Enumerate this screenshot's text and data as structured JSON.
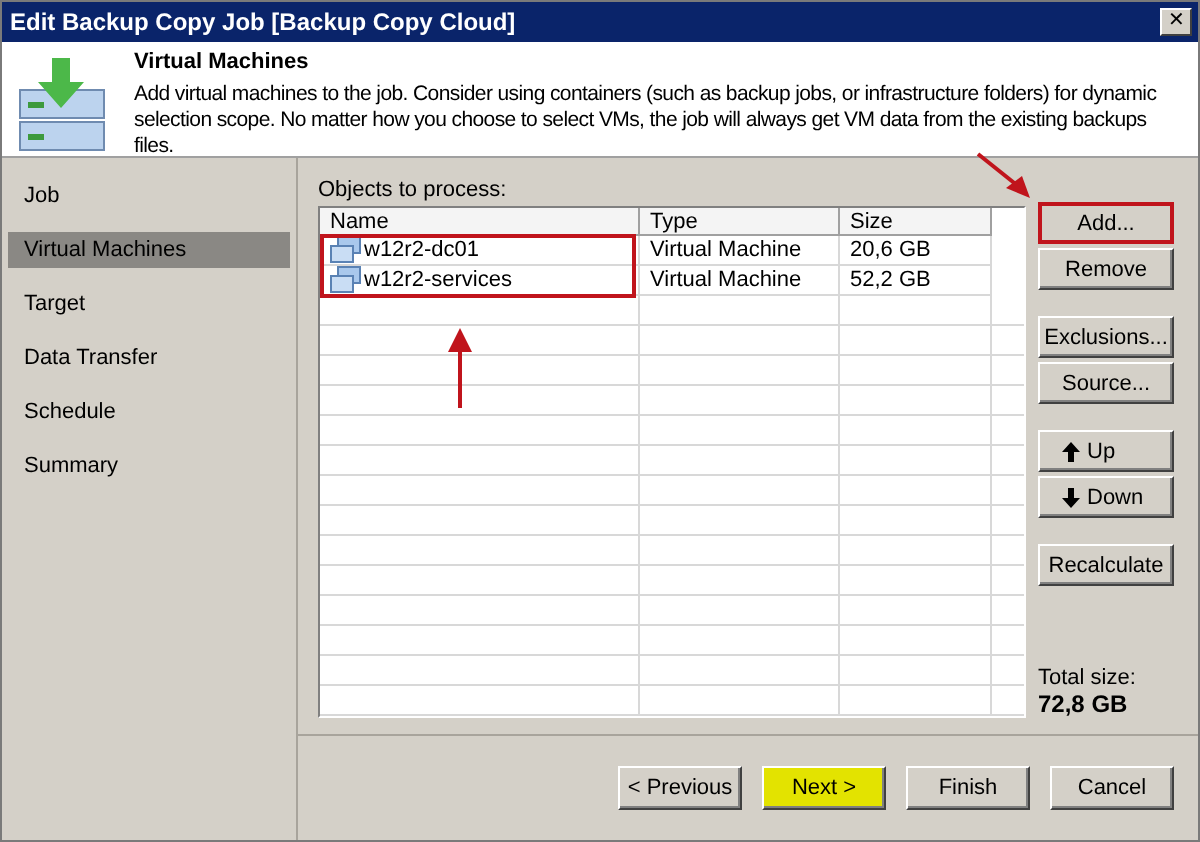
{
  "window": {
    "title": "Edit Backup Copy Job [Backup Copy Cloud]",
    "close": "✕"
  },
  "header": {
    "title": "Virtual Machines",
    "description": "Add virtual machines to the job. Consider using containers (such as backup jobs, or infrastructure folders) for dynamic selection scope. No matter how you choose to select VMs, the job will always get VM data from the existing backups files."
  },
  "sidebar": {
    "items": [
      {
        "label": "Job",
        "selected": false
      },
      {
        "label": "Virtual Machines",
        "selected": true
      },
      {
        "label": "Target",
        "selected": false
      },
      {
        "label": "Data Transfer",
        "selected": false
      },
      {
        "label": "Schedule",
        "selected": false
      },
      {
        "label": "Summary",
        "selected": false
      }
    ]
  },
  "objects": {
    "label": "Objects to process:",
    "columns": [
      "Name",
      "Type",
      "Size"
    ],
    "rows": [
      {
        "name": "w12r2-dc01",
        "type": "Virtual Machine",
        "size": "20,6 GB"
      },
      {
        "name": "w12r2-services",
        "type": "Virtual Machine",
        "size": "52,2 GB"
      }
    ],
    "rows_highlighted": true
  },
  "side_button_groups": [
    [
      {
        "label": "Add...",
        "kind": "plain",
        "highlighted": true
      },
      {
        "label": "Remove",
        "kind": "plain",
        "highlighted": false
      }
    ],
    [
      {
        "label": "Exclusions...",
        "kind": "plain",
        "highlighted": false
      },
      {
        "label": "Source...",
        "kind": "plain",
        "highlighted": false
      }
    ],
    [
      {
        "label": "Up",
        "kind": "up",
        "highlighted": false
      },
      {
        "label": "Down",
        "kind": "down",
        "highlighted": false
      }
    ],
    [
      {
        "label": "Recalculate",
        "kind": "plain",
        "highlighted": false
      }
    ]
  ],
  "total": {
    "label": "Total size:",
    "value": "72,8 GB"
  },
  "footer_buttons": [
    {
      "label": "< Previous",
      "highlighted": false
    },
    {
      "label": "Next >",
      "highlighted": true
    },
    {
      "label": "Finish",
      "highlighted": false
    },
    {
      "label": "Cancel",
      "highlighted": false
    }
  ]
}
